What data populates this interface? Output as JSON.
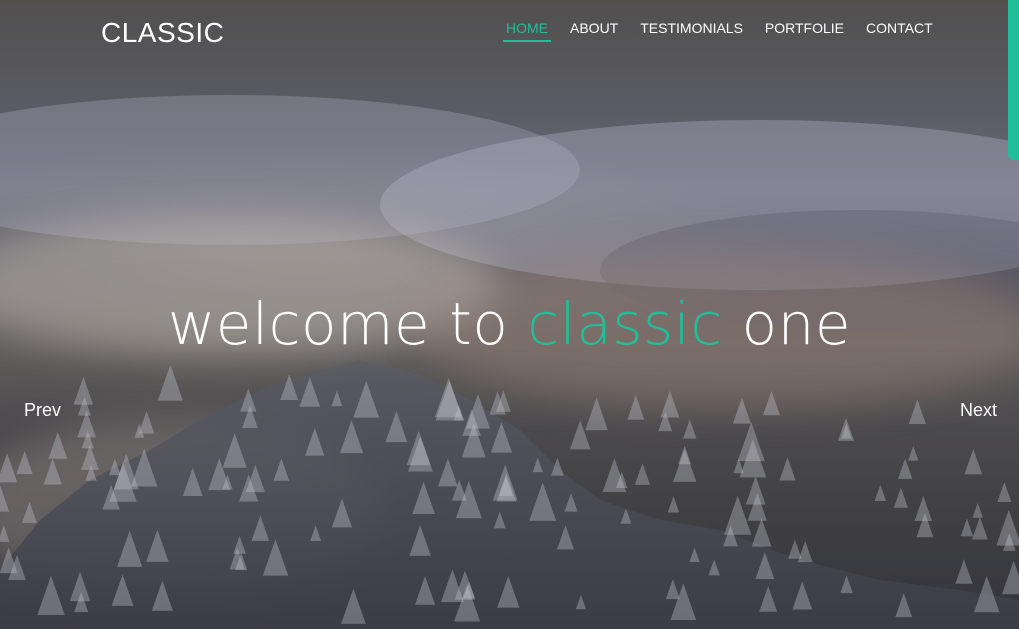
{
  "brand": {
    "logo_text": "CLASSIC"
  },
  "nav": {
    "items": [
      {
        "label": "HOME",
        "active": true
      },
      {
        "label": "ABOUT",
        "active": false
      },
      {
        "label": "TESTIMONIALS",
        "active": false
      },
      {
        "label": "PORTFOLIE",
        "active": false
      },
      {
        "label": "CONTACT",
        "active": false
      }
    ]
  },
  "hero": {
    "headline_prefix": "welcome to ",
    "headline_accent": "classic",
    "headline_suffix": " one",
    "prev_label": "Prev",
    "next_label": "Next"
  },
  "colors": {
    "accent": "#1fbf9b",
    "text": "#ffffff"
  },
  "icons": {
    "forest": "pine-tree-icon"
  }
}
